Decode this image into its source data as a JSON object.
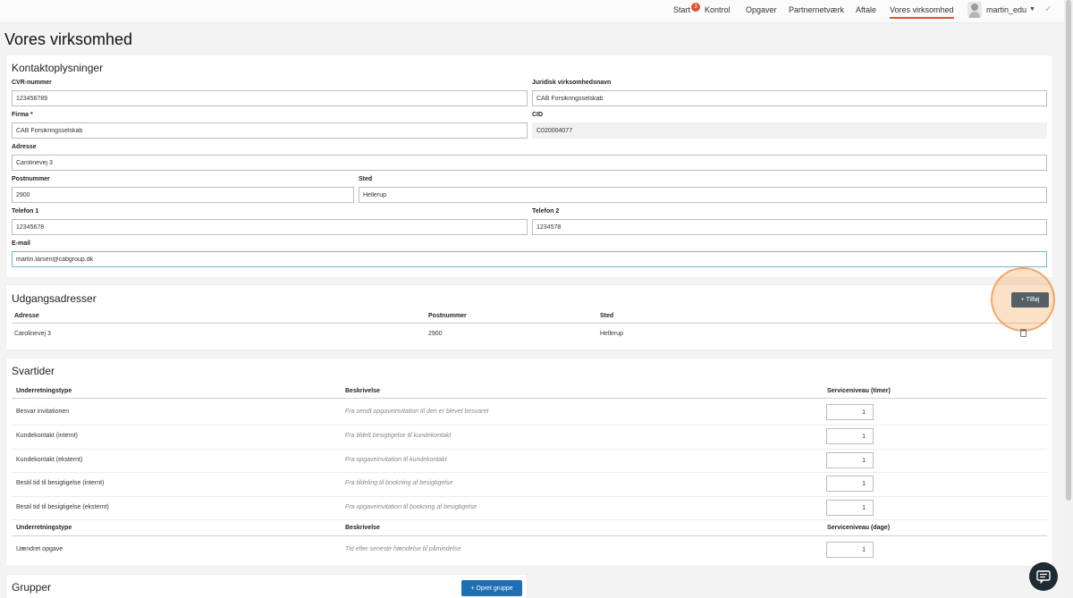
{
  "nav": {
    "items": [
      "Start",
      "Kontrol",
      "Opgaver",
      "Partnernetværk",
      "Aftale",
      "Vores virksomhed"
    ],
    "badge": "3",
    "user": "martin_edu",
    "active": "Vores virksomhed"
  },
  "page_title": "Vores virksomhed",
  "contact": {
    "title": "Kontaktoplysninger",
    "cvr_label": "CVR-nummer",
    "cvr_value": "123456789",
    "legal_label": "Juridisk virksomhedsnavn",
    "legal_value": "CAB Forsikringsselskab",
    "firma_label": "Firma *",
    "firma_value": "CAB Forsikringsselskab",
    "cid_label": "CID",
    "cid_value": "C020004077",
    "adresse_label": "Adresse",
    "adresse_value": "Carolinevej 3",
    "postnr_label": "Postnummer",
    "postnr_value": "2900",
    "sted_label": "Sted",
    "sted_value": "Hellerup",
    "tel1_label": "Telefon 1",
    "tel1_value": "12345678",
    "tel2_label": "Telefon 2",
    "tel2_value": "1234578",
    "email_label": "E-mail",
    "email_value": "martin.larsen@cabgroup.dk"
  },
  "outgoing": {
    "title": "Udgangsadresser",
    "add_button": "+ Tilføj",
    "headers": [
      "Adresse",
      "Postnummer",
      "Sted"
    ],
    "rows": [
      {
        "adresse": "Carolinevej 3",
        "postnummer": "2900",
        "sted": "Hellerup"
      }
    ]
  },
  "response": {
    "title": "Svartider",
    "headers_hours": [
      "Underretningstype",
      "Beskrivelse",
      "Serviceniveau (timer)"
    ],
    "rows_hours": [
      {
        "type": "Besvar invitationen",
        "desc": "Fra sendt opgaveinvitation til den er blevet besvaret",
        "value": "1"
      },
      {
        "type": "Kundekontakt (internt)",
        "desc": "Fra tildelt besigtigelse til kundekontakt",
        "value": "1"
      },
      {
        "type": "Kundekontakt (eksternt)",
        "desc": "Fra opgaveinvitation til kundekontakt",
        "value": "1"
      },
      {
        "type": "Bestil tid til besigtigelse (internt)",
        "desc": "Fra tildeling til bookning af besigtigelse",
        "value": "1"
      },
      {
        "type": "Bestil tid til besigtigelse (eksternt)",
        "desc": "Fra opgaveinvitation til bookning af besigtigelse",
        "value": "1"
      }
    ],
    "headers_days": [
      "Underretningstype",
      "Beskrivelse",
      "Serviceniveau (dage)"
    ],
    "rows_days": [
      {
        "type": "Uændret opgave",
        "desc": "Tid efter seneste hændelse til påmindelse",
        "value": "1"
      }
    ]
  },
  "groups": {
    "title": "Grupper",
    "create_button": "+ Opret gruppe"
  },
  "icons": {
    "chat": "chat-icon",
    "trash": "trash-icon",
    "check": "check-icon",
    "caret": "caret-down-icon"
  }
}
